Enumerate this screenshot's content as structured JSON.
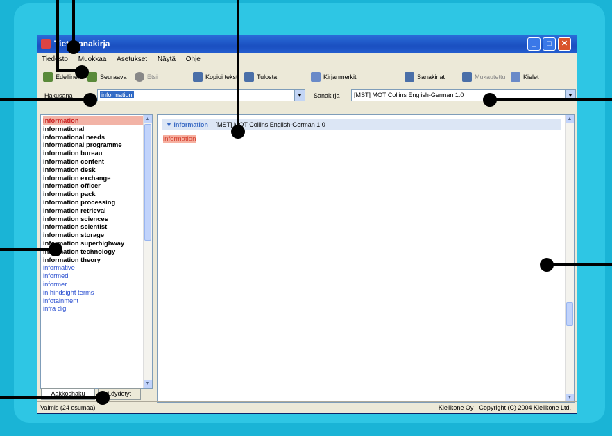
{
  "window": {
    "title": "Tietosanakirja",
    "close_glyph": "✕",
    "min_glyph": "_",
    "max_glyph": "□"
  },
  "menu": [
    "Tiedosto",
    "Muokkaa",
    "Asetukset",
    "Näytä",
    "Ohje"
  ],
  "toolbar": {
    "btn1": "Edellinen",
    "btn2": "Seuraava",
    "btn3": "Etsi",
    "btn4": "Kopioi teksti",
    "btn5": "Tulosta",
    "btn6": "Kirjanmerkit",
    "btn7": "Sanakirjat",
    "btn8": "Mukautettu",
    "btn9": "Kielet"
  },
  "search": {
    "label": "Hakusana",
    "value": "information",
    "dict_label": "Sanakirja",
    "dict_value": "[MST] MOT Collins English-German 1.0"
  },
  "wordlist": [
    {
      "text": "information",
      "style": "hl"
    },
    {
      "text": "informational",
      "style": ""
    },
    {
      "text": "informational needs",
      "style": ""
    },
    {
      "text": "informational programme",
      "style": ""
    },
    {
      "text": "information bureau",
      "style": ""
    },
    {
      "text": "information content",
      "style": ""
    },
    {
      "text": "information desk",
      "style": ""
    },
    {
      "text": "information exchange",
      "style": ""
    },
    {
      "text": "information officer",
      "style": ""
    },
    {
      "text": "information pack",
      "style": ""
    },
    {
      "text": "information processing",
      "style": ""
    },
    {
      "text": "information retrieval",
      "style": ""
    },
    {
      "text": "information sciences",
      "style": ""
    },
    {
      "text": "information scientist",
      "style": ""
    },
    {
      "text": "information storage",
      "style": ""
    },
    {
      "text": "information superhighway",
      "style": ""
    },
    {
      "text": "information technology",
      "style": ""
    },
    {
      "text": "information theory",
      "style": ""
    },
    {
      "text": "informative",
      "style": "blue"
    },
    {
      "text": "informed",
      "style": "blue"
    },
    {
      "text": "informer",
      "style": "blue"
    },
    {
      "text": "in hindsight terms",
      "style": "blue"
    },
    {
      "text": "infotainment",
      "style": "blue"
    },
    {
      "text": "infra dig",
      "style": "blue"
    }
  ],
  "tabs": [
    "Aakkoshaku",
    "Löydetyt"
  ],
  "entry": {
    "headword": "information",
    "source": "[MST] MOT Collins English-German 1.0"
  },
  "statusbar": {
    "left": "Valmis (24 osumaa)",
    "right": "Kielikone Oy · Copyright (C) 2004 Kielikone Ltd."
  }
}
